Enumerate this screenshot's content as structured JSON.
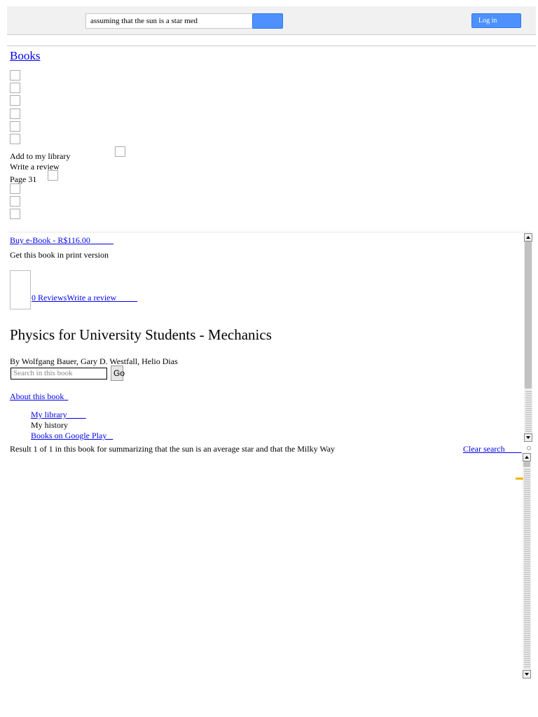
{
  "header": {
    "search_value": "assuming that the sun is a star med",
    "login_label": "Log in"
  },
  "nav": {
    "books_label": "Books"
  },
  "actions": {
    "add_to_library": "Add to my library",
    "write_review": "Write a review",
    "page": "Page 31"
  },
  "buy": {
    "ebook_label": "Buy e-Book - R$116.00",
    "print_label": "Get this book in print version"
  },
  "reviews": {
    "count_label": "0 Reviews",
    "write_label": "Write a review"
  },
  "book": {
    "title": "Physics for University Students - Mechanics",
    "authors": "By Wolfgang Bauer, Gary D. Westfall, Helio Dias"
  },
  "inbook_search": {
    "placeholder": "Search in this book",
    "go_label": "Go"
  },
  "about_label": "About this book",
  "library_menu": {
    "my_library": "My library",
    "my_history": "My history",
    "play": "Books on Google Play"
  },
  "results": {
    "text": "Result 1 of 1 in this book for summarizing that the sun is an average star and that the Milky Way",
    "clear_label": "Clear search"
  },
  "colors": {
    "accent": "#4d90fe",
    "link": "#0000ee",
    "highlight": "#f4b400"
  }
}
